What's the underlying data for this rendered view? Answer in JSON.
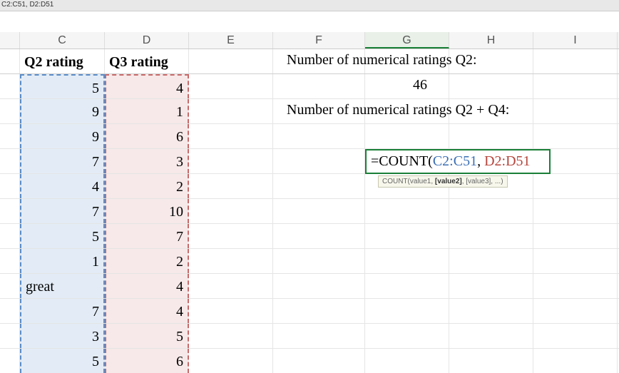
{
  "namebox": "C2:C51, D2:D51",
  "columns": {
    "c": "C",
    "d": "D",
    "e": "E",
    "f": "F",
    "g": "G",
    "h": "H",
    "i": "I"
  },
  "headers": {
    "c": "Q2 rating",
    "d": "Q3 rating"
  },
  "rows": [
    {
      "c": "5",
      "d": "4"
    },
    {
      "c": "9",
      "d": "1"
    },
    {
      "c": "9",
      "d": "6"
    },
    {
      "c": "7",
      "d": "3"
    },
    {
      "c": "4",
      "d": "2"
    },
    {
      "c": "7",
      "d": "10"
    },
    {
      "c": "5",
      "d": "7"
    },
    {
      "c": "1",
      "d": "2"
    },
    {
      "c": "great",
      "d": "4",
      "c_left": true
    },
    {
      "c": "7",
      "d": "4"
    },
    {
      "c": "3",
      "d": "5"
    },
    {
      "c": "5",
      "d": "6"
    }
  ],
  "labels": {
    "q2_label": "Number of numerical ratings Q2:",
    "q2_value": "46",
    "q2q4_label": "Number of numerical ratings Q2 + Q4:"
  },
  "formula": {
    "prefix": "=COUNT(",
    "range1": "C2:C51",
    "sep": ", ",
    "range2": "D2:D51"
  },
  "tooltip": {
    "fn": "COUNT(",
    "a1": "value1",
    "a2": "[value2]",
    "rest": ", [value3], ...)"
  }
}
